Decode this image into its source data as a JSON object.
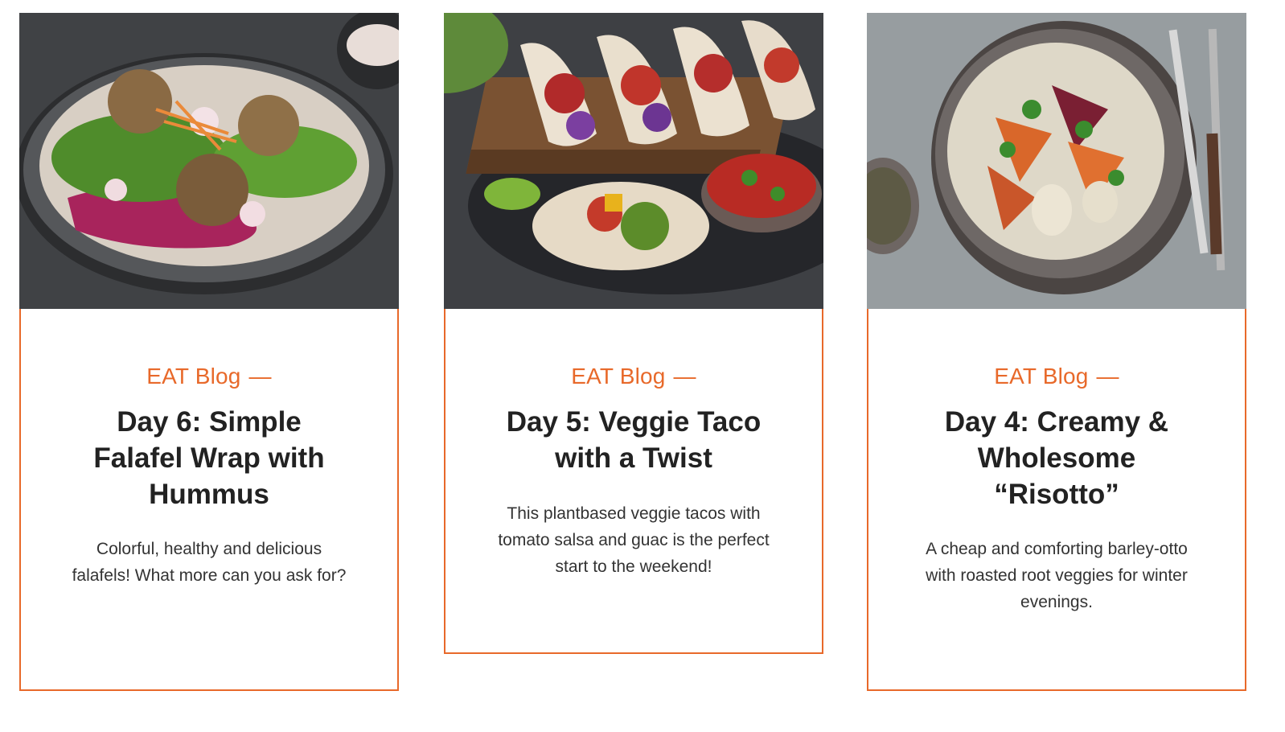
{
  "cards": [
    {
      "kicker": "EAT Blog",
      "dash": "—",
      "title": "Day 6: Simple Falafel Wrap with Hummus",
      "description": "Colorful, healthy and delicious falafels! What more can you ask for?",
      "image_alt": "falafel-wrap-photo"
    },
    {
      "kicker": "EAT Blog",
      "dash": "—",
      "title": "Day 5: Veggie Taco with a Twist",
      "description": "This plantbased veggie tacos with tomato salsa and guac is the perfect start to the weekend!",
      "image_alt": "veggie-taco-photo"
    },
    {
      "kicker": "EAT Blog",
      "dash": "—",
      "title": "Day 4: Creamy & Wholesome “Risotto”",
      "description": "A cheap and comforting barley-otto with roasted root veggies for winter evenings.",
      "image_alt": "barley-risotto-photo"
    }
  ],
  "colors": {
    "accent": "#e8692a",
    "text": "#222222"
  }
}
